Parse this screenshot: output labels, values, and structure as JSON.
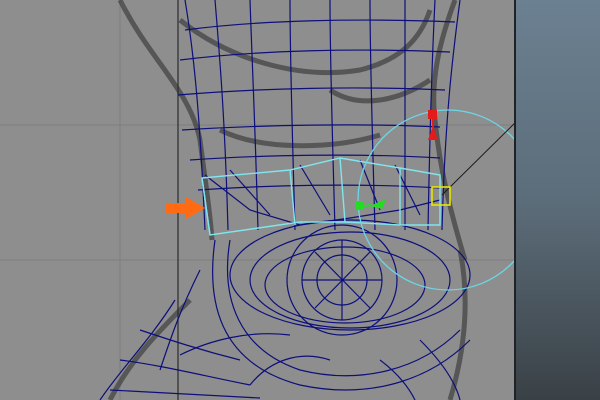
{
  "app": {
    "view": "perspective-viewport"
  },
  "colors": {
    "viewport_background": "#8e8e8e",
    "wireframe": "#0d0f7a",
    "selected_faces": "#7fe6ee",
    "manipulator_ring": "#6bd6e6",
    "x_axis_handle": "#e31b1b",
    "y_axis_handle": "#22dd22",
    "pivot_handle": "#e6e600",
    "annotation_arrow": "#ff6a13",
    "sketch_lines": "#2a2a2a"
  },
  "icons": {
    "annotation_arrow": "orange-arrow-icon",
    "pivot_handle": "pivot-square-icon",
    "ring_center": "circle-target-icon"
  }
}
